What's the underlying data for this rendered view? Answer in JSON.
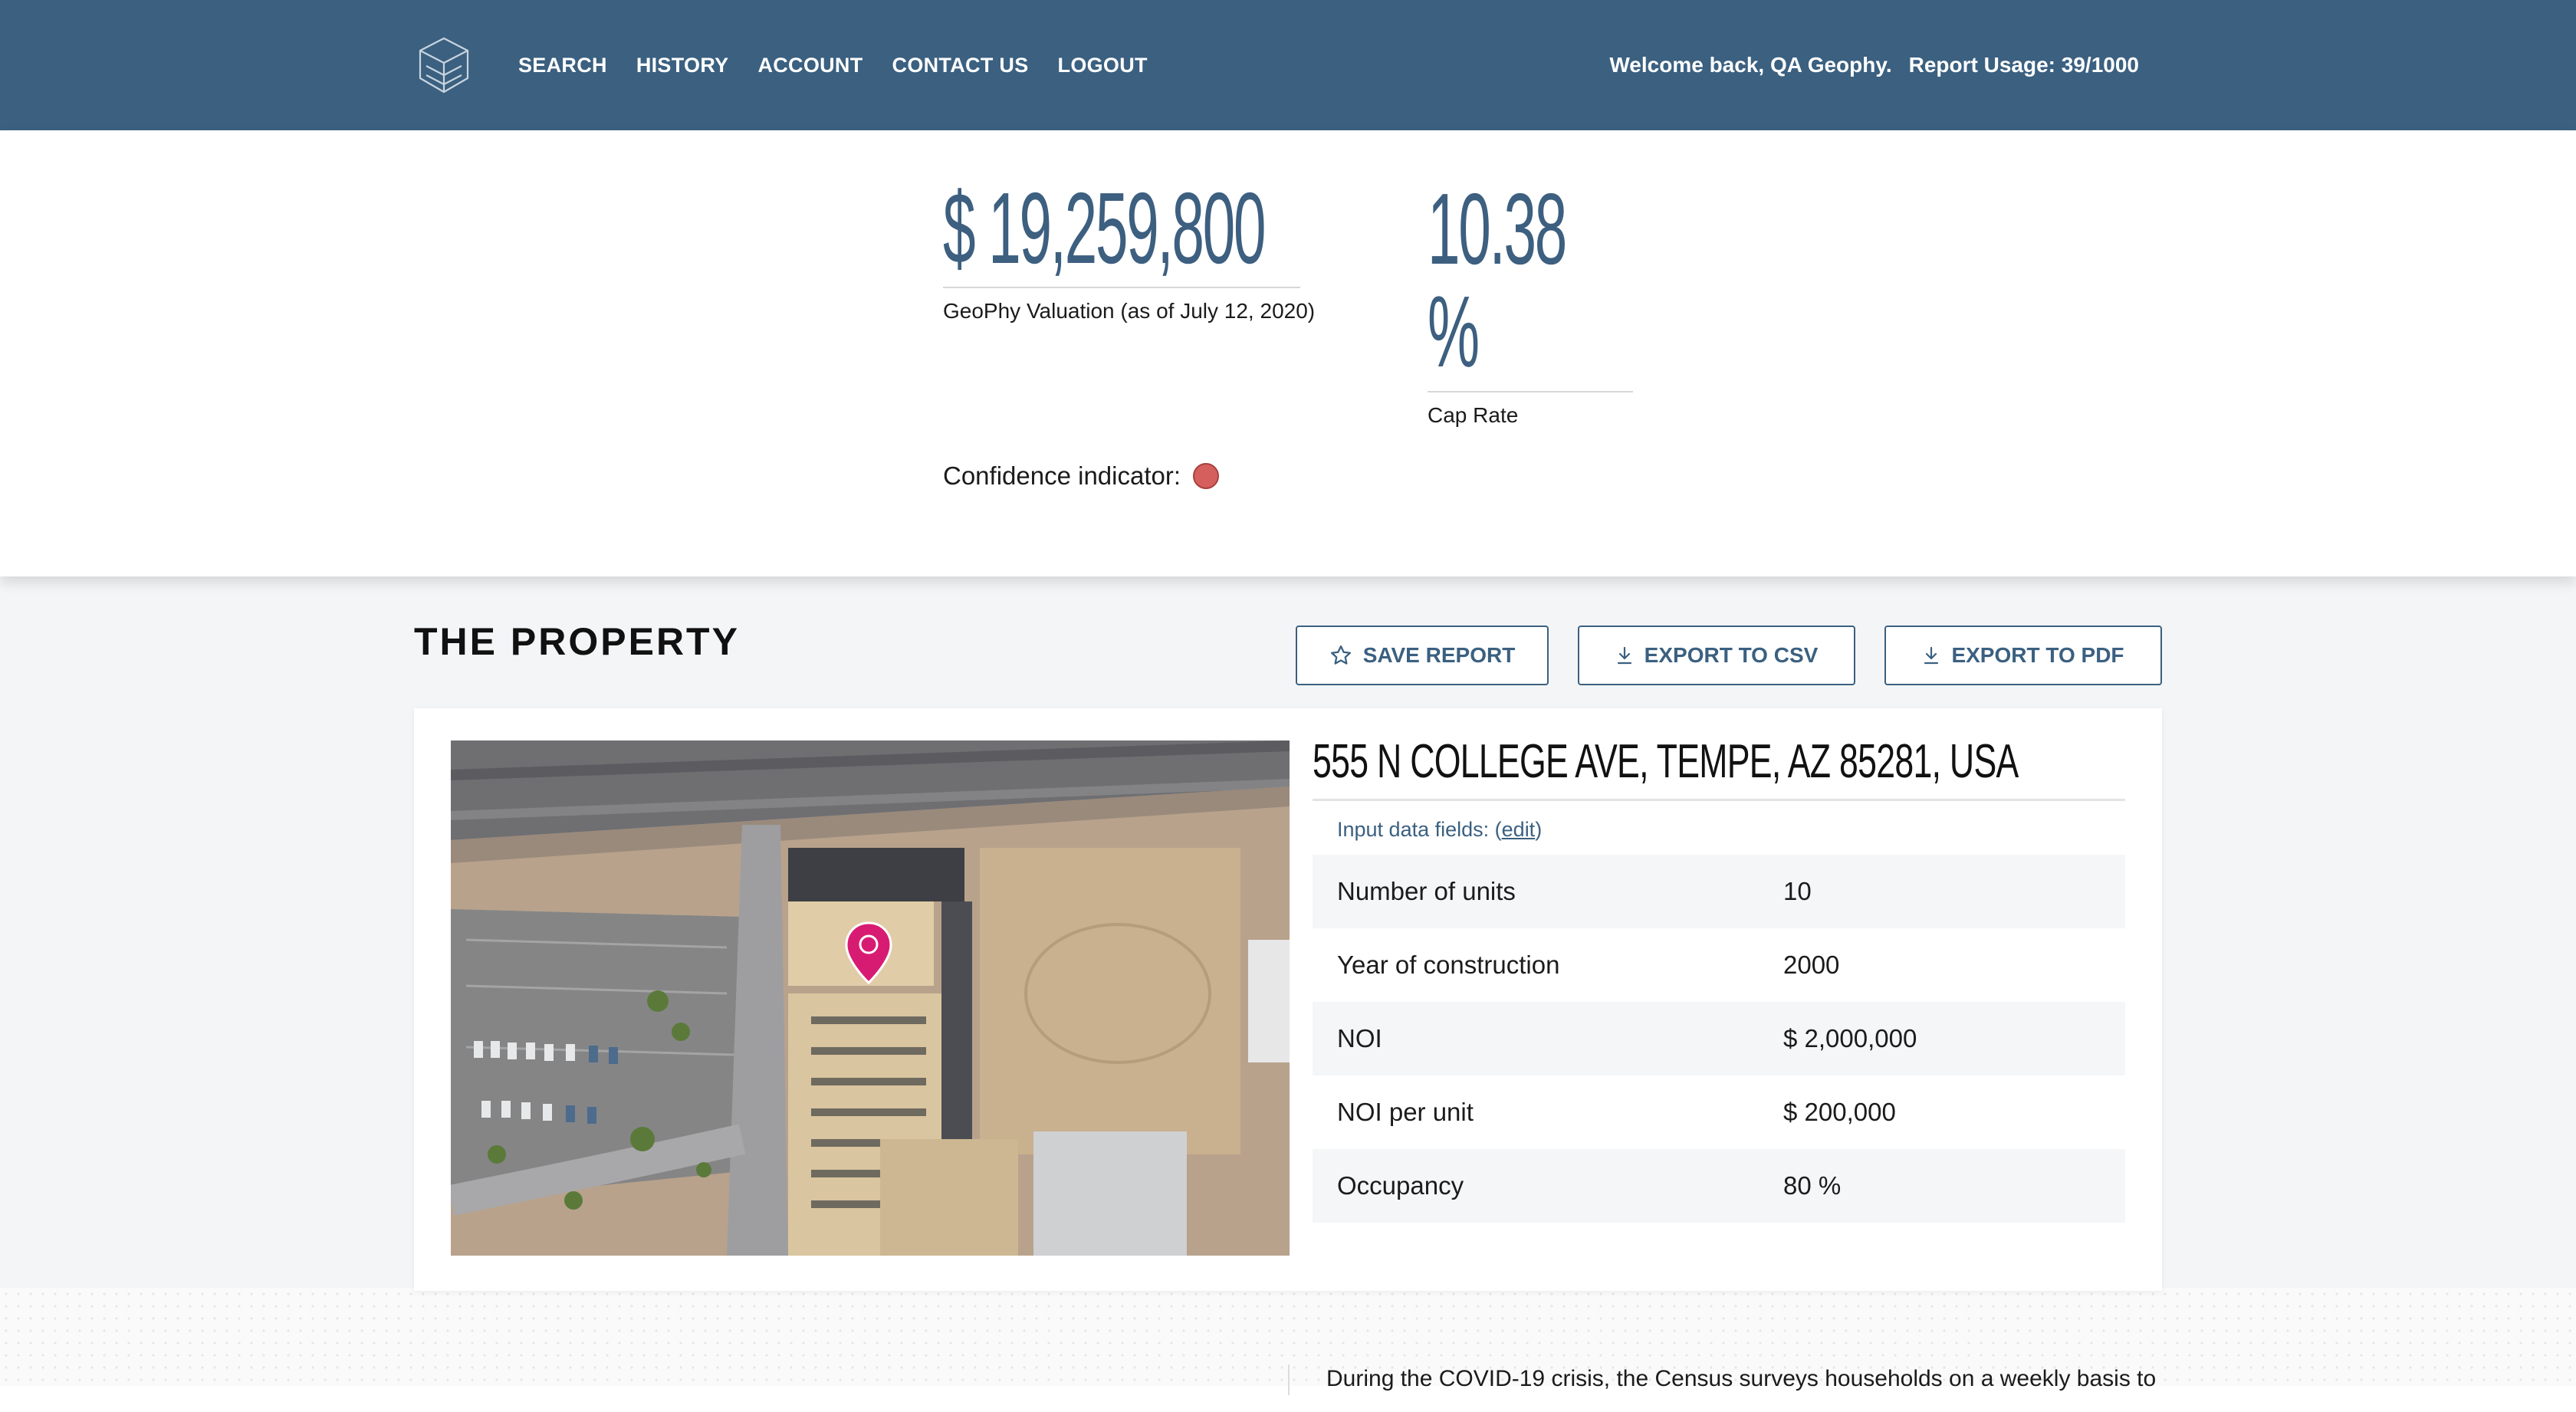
{
  "nav": {
    "items": [
      "SEARCH",
      "HISTORY",
      "ACCOUNT",
      "CONTACT US",
      "LOGOUT"
    ],
    "welcome": "Welcome back, QA Geophy.",
    "usage": "Report Usage: 39/1000"
  },
  "valuation": {
    "amount": "$ 19,259,800",
    "caption": "GeoPhy Valuation (as of July 12, 2020)",
    "cap_rate_value": "10.38",
    "cap_rate_unit": "%",
    "cap_rate_label": "Cap Rate",
    "confidence_label": "Confidence indicator:",
    "confidence_color": "#d55f5c"
  },
  "property": {
    "section_title": "THE PROPERTY",
    "buttons": {
      "save": "SAVE REPORT",
      "csv": "EXPORT TO CSV",
      "pdf": "EXPORT TO PDF"
    },
    "address": "555 N COLLEGE AVE, TEMPE, AZ 85281, USA",
    "input_fields_label": "Input data fields:",
    "edit_label": "edit",
    "fields": [
      {
        "label": "Number of units",
        "value": "10"
      },
      {
        "label": "Year of construction",
        "value": "2000"
      },
      {
        "label": "NOI",
        "value": "$ 2,000,000"
      },
      {
        "label": "NOI per unit",
        "value": "$ 200,000"
      },
      {
        "label": "Occupancy",
        "value": "80 %"
      }
    ]
  },
  "footer_text": "During the COVID-19 crisis, the Census surveys households on a weekly basis to",
  "colors": {
    "brand": "#3b6080",
    "marker": "#d81b72"
  }
}
